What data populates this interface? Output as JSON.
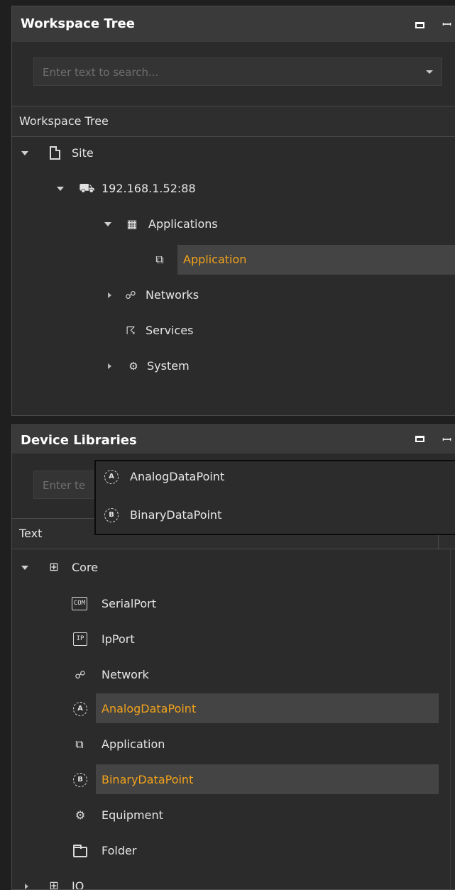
{
  "workspace": {
    "title": "Workspace Tree",
    "search_placeholder": "Enter text to search...",
    "column_header": "Workspace Tree",
    "items": {
      "site": "Site",
      "device": "192.168.1.52:88",
      "applications": "Applications",
      "application": "Application",
      "networks": "Networks",
      "services": "Services",
      "system": "System"
    }
  },
  "libraries": {
    "title": "Device Libraries",
    "search_placeholder": "Enter te",
    "column_header": "Text",
    "popup": [
      "AnalogDataPoint",
      "BinaryDataPoint"
    ],
    "items": {
      "core": "Core",
      "serialport": "SerialPort",
      "ipport": "IpPort",
      "network": "Network",
      "analog": "AnalogDataPoint",
      "application": "Application",
      "binary": "BinaryDataPoint",
      "equipment": "Equipment",
      "folder": "Folder",
      "io": "IO"
    }
  },
  "icons": {
    "com_badge": "COM",
    "ip_badge": "IP",
    "analog_letter": "A",
    "binary_letter": "B"
  },
  "colors": {
    "highlight": "#f0a21a",
    "selection_bg": "#444444"
  }
}
